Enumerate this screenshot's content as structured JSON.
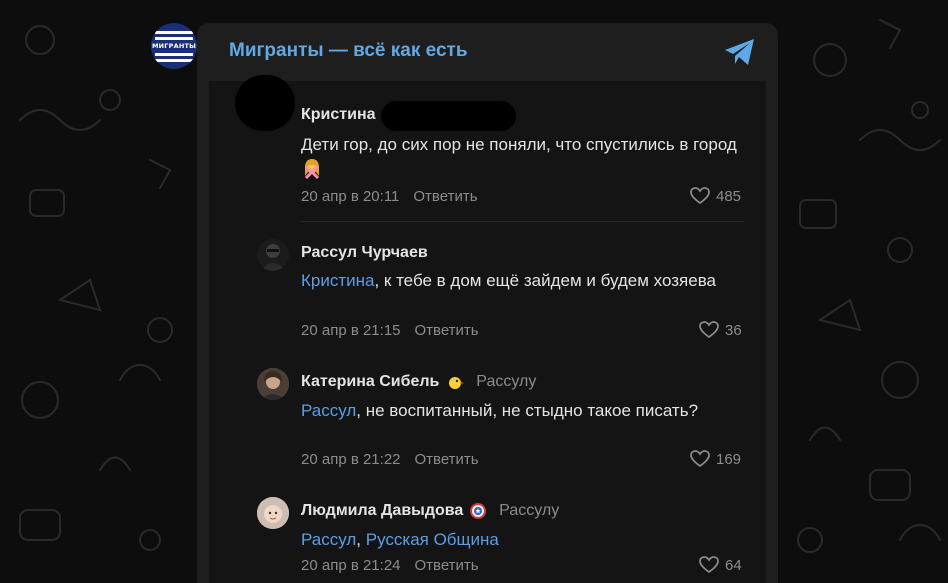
{
  "channel": {
    "title": "Мигранты — всё как есть",
    "logo_text": "МИГРАНТЫ",
    "accent_color": "#5fa9e6",
    "share_icon": "telegram-share-icon"
  },
  "comments": [
    {
      "author": "Кристина",
      "text": "Дети гор, до сих пор не поняли, что спустились в город",
      "emoji": "woman-gesturing-no-emoji",
      "date": "20 апр в 20:11",
      "reply_label": "Ответить",
      "likes": "485"
    },
    {
      "author": "Рассул Чурчаев",
      "mention": "Кристина",
      "text": ", к тебе в дом ещё зайдем и будем хозяева",
      "date": "20 апр в 21:15",
      "reply_label": "Ответить",
      "likes": "36"
    },
    {
      "author": "Катерина Сибель",
      "author_emoji": "chick-emoji",
      "reply_to": "Рассулу",
      "mention": "Рассул",
      "text": ", не воспитанный, не стыдно такое писать?",
      "date": "20 апр в 21:22",
      "reply_label": "Ответить",
      "likes": "169"
    },
    {
      "author": "Людмила Давыдова",
      "author_emoji": "captain-america-shield-emoji",
      "reply_to": "Рассулу",
      "mention": "Рассул",
      "mention_separator": ", ",
      "mention2": "Русская Община",
      "date": "20 апр в 21:24",
      "reply_label": "Ответить",
      "likes": "64"
    }
  ],
  "colors": {
    "link": "#5b9ee8",
    "meta": "#8c8c8c",
    "text": "#e4e4e4"
  }
}
